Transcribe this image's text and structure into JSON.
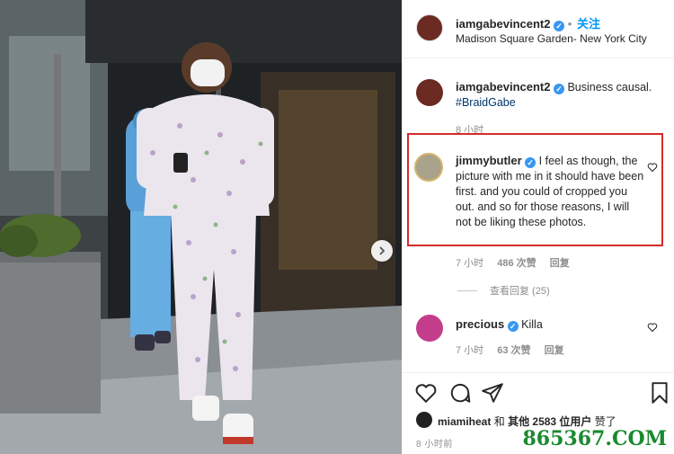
{
  "post": {
    "author": "iamgabevincent2",
    "verified_glyph": "✓",
    "follow_label": "关注",
    "separator": "•",
    "location": "Madison Square Garden- New York City",
    "caption_text": "Business causal.",
    "caption_hashtag": "#BraidGabe",
    "caption_time": "8 小时"
  },
  "comments": [
    {
      "user": "jimmybutler",
      "text": "I feel as though, the picture with me in it should have been first. and you could of cropped you out. and so for those reasons, I will not be liking these photos.",
      "time": "7 小时",
      "likes": "486 次赞",
      "reply": "回复",
      "view_replies": "查看回复 (25)",
      "highlighted": true,
      "highlight_color": "#d72a2a"
    },
    {
      "user": "precious",
      "text": "Killa",
      "time": "7 小时",
      "likes": "63 次赞",
      "reply": "回复"
    }
  ],
  "actions": {
    "icons": [
      "heart-icon",
      "comment-icon",
      "share-icon",
      "bookmark-icon"
    ]
  },
  "likes_summary": {
    "user": "miamiheat",
    "and": "和",
    "others": "其他 2583 位用户",
    "suffix": "赞了"
  },
  "posted_time": "8 小时前",
  "watermark": "865367.COM",
  "colors": {
    "accent": "#0095f6",
    "verified": "#3897f0",
    "highlight_border": "#d72a2a",
    "watermark": "#1a8a2e"
  }
}
